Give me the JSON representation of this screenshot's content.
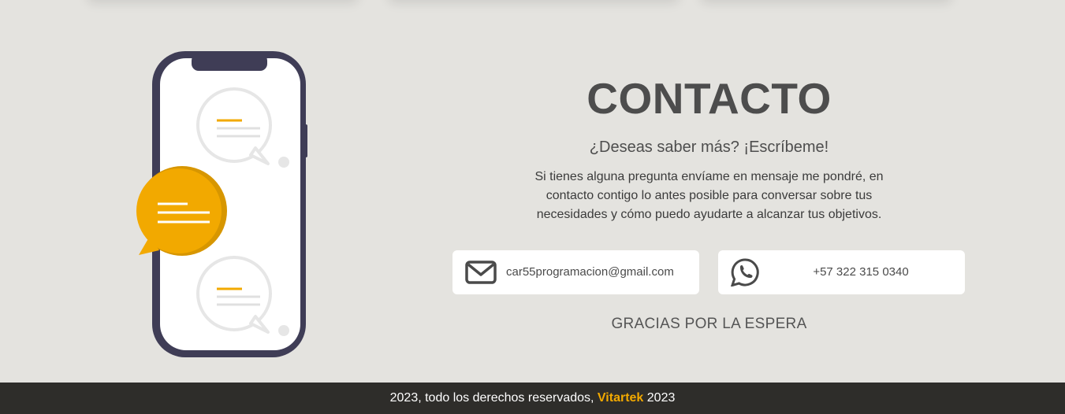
{
  "contact": {
    "title": "CONTACTO",
    "subtitle": "¿Deseas saber más? ¡Escríbeme!",
    "description": "Si tienes alguna pregunta envíame en mensaje me pondré, en contacto contigo lo antes posible para conversar sobre tus necesidades y cómo puedo ayudarte a alcanzar tus objetivos.",
    "email": {
      "value": "car55programacion@gmail.com",
      "icon": "mail-icon"
    },
    "phone": {
      "value": "+57 322 315 0340",
      "icon": "whatsapp-icon"
    },
    "thanks": "GRACIAS POR LA ESPERA"
  },
  "illustration": {
    "icon": "phone-chat-illustration"
  },
  "footer": {
    "prefix": "2023, todo los derechos reservados,",
    "brand": "Vitartek",
    "suffix": "2023"
  },
  "colors": {
    "background": "#e4e3df",
    "accent": "#f2a900",
    "phone_frame": "#3f3d56",
    "footer_bg": "#2e2d2a"
  }
}
